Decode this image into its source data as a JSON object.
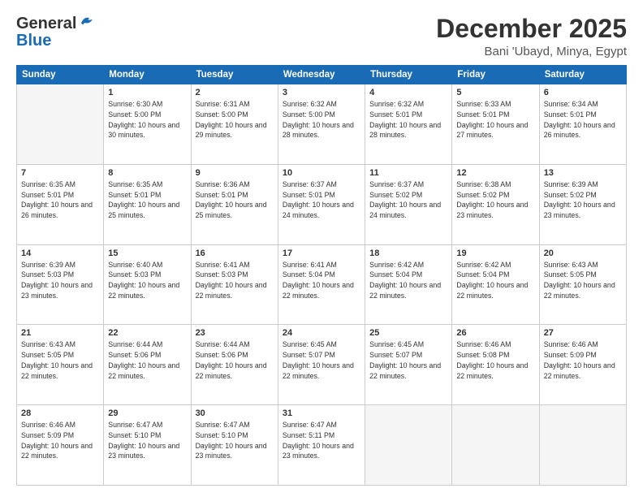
{
  "header": {
    "logo_general": "General",
    "logo_blue": "Blue",
    "month": "December 2025",
    "location": "Bani 'Ubayd, Minya, Egypt"
  },
  "weekdays": [
    "Sunday",
    "Monday",
    "Tuesday",
    "Wednesday",
    "Thursday",
    "Friday",
    "Saturday"
  ],
  "weeks": [
    [
      {
        "day": "",
        "sunrise": "",
        "sunset": "",
        "daylight": ""
      },
      {
        "day": "1",
        "sunrise": "Sunrise: 6:30 AM",
        "sunset": "Sunset: 5:00 PM",
        "daylight": "Daylight: 10 hours and 30 minutes."
      },
      {
        "day": "2",
        "sunrise": "Sunrise: 6:31 AM",
        "sunset": "Sunset: 5:00 PM",
        "daylight": "Daylight: 10 hours and 29 minutes."
      },
      {
        "day": "3",
        "sunrise": "Sunrise: 6:32 AM",
        "sunset": "Sunset: 5:00 PM",
        "daylight": "Daylight: 10 hours and 28 minutes."
      },
      {
        "day": "4",
        "sunrise": "Sunrise: 6:32 AM",
        "sunset": "Sunset: 5:01 PM",
        "daylight": "Daylight: 10 hours and 28 minutes."
      },
      {
        "day": "5",
        "sunrise": "Sunrise: 6:33 AM",
        "sunset": "Sunset: 5:01 PM",
        "daylight": "Daylight: 10 hours and 27 minutes."
      },
      {
        "day": "6",
        "sunrise": "Sunrise: 6:34 AM",
        "sunset": "Sunset: 5:01 PM",
        "daylight": "Daylight: 10 hours and 26 minutes."
      }
    ],
    [
      {
        "day": "7",
        "sunrise": "Sunrise: 6:35 AM",
        "sunset": "Sunset: 5:01 PM",
        "daylight": "Daylight: 10 hours and 26 minutes."
      },
      {
        "day": "8",
        "sunrise": "Sunrise: 6:35 AM",
        "sunset": "Sunset: 5:01 PM",
        "daylight": "Daylight: 10 hours and 25 minutes."
      },
      {
        "day": "9",
        "sunrise": "Sunrise: 6:36 AM",
        "sunset": "Sunset: 5:01 PM",
        "daylight": "Daylight: 10 hours and 25 minutes."
      },
      {
        "day": "10",
        "sunrise": "Sunrise: 6:37 AM",
        "sunset": "Sunset: 5:01 PM",
        "daylight": "Daylight: 10 hours and 24 minutes."
      },
      {
        "day": "11",
        "sunrise": "Sunrise: 6:37 AM",
        "sunset": "Sunset: 5:02 PM",
        "daylight": "Daylight: 10 hours and 24 minutes."
      },
      {
        "day": "12",
        "sunrise": "Sunrise: 6:38 AM",
        "sunset": "Sunset: 5:02 PM",
        "daylight": "Daylight: 10 hours and 23 minutes."
      },
      {
        "day": "13",
        "sunrise": "Sunrise: 6:39 AM",
        "sunset": "Sunset: 5:02 PM",
        "daylight": "Daylight: 10 hours and 23 minutes."
      }
    ],
    [
      {
        "day": "14",
        "sunrise": "Sunrise: 6:39 AM",
        "sunset": "Sunset: 5:03 PM",
        "daylight": "Daylight: 10 hours and 23 minutes."
      },
      {
        "day": "15",
        "sunrise": "Sunrise: 6:40 AM",
        "sunset": "Sunset: 5:03 PM",
        "daylight": "Daylight: 10 hours and 22 minutes."
      },
      {
        "day": "16",
        "sunrise": "Sunrise: 6:41 AM",
        "sunset": "Sunset: 5:03 PM",
        "daylight": "Daylight: 10 hours and 22 minutes."
      },
      {
        "day": "17",
        "sunrise": "Sunrise: 6:41 AM",
        "sunset": "Sunset: 5:04 PM",
        "daylight": "Daylight: 10 hours and 22 minutes."
      },
      {
        "day": "18",
        "sunrise": "Sunrise: 6:42 AM",
        "sunset": "Sunset: 5:04 PM",
        "daylight": "Daylight: 10 hours and 22 minutes."
      },
      {
        "day": "19",
        "sunrise": "Sunrise: 6:42 AM",
        "sunset": "Sunset: 5:04 PM",
        "daylight": "Daylight: 10 hours and 22 minutes."
      },
      {
        "day": "20",
        "sunrise": "Sunrise: 6:43 AM",
        "sunset": "Sunset: 5:05 PM",
        "daylight": "Daylight: 10 hours and 22 minutes."
      }
    ],
    [
      {
        "day": "21",
        "sunrise": "Sunrise: 6:43 AM",
        "sunset": "Sunset: 5:05 PM",
        "daylight": "Daylight: 10 hours and 22 minutes."
      },
      {
        "day": "22",
        "sunrise": "Sunrise: 6:44 AM",
        "sunset": "Sunset: 5:06 PM",
        "daylight": "Daylight: 10 hours and 22 minutes."
      },
      {
        "day": "23",
        "sunrise": "Sunrise: 6:44 AM",
        "sunset": "Sunset: 5:06 PM",
        "daylight": "Daylight: 10 hours and 22 minutes."
      },
      {
        "day": "24",
        "sunrise": "Sunrise: 6:45 AM",
        "sunset": "Sunset: 5:07 PM",
        "daylight": "Daylight: 10 hours and 22 minutes."
      },
      {
        "day": "25",
        "sunrise": "Sunrise: 6:45 AM",
        "sunset": "Sunset: 5:07 PM",
        "daylight": "Daylight: 10 hours and 22 minutes."
      },
      {
        "day": "26",
        "sunrise": "Sunrise: 6:46 AM",
        "sunset": "Sunset: 5:08 PM",
        "daylight": "Daylight: 10 hours and 22 minutes."
      },
      {
        "day": "27",
        "sunrise": "Sunrise: 6:46 AM",
        "sunset": "Sunset: 5:09 PM",
        "daylight": "Daylight: 10 hours and 22 minutes."
      }
    ],
    [
      {
        "day": "28",
        "sunrise": "Sunrise: 6:46 AM",
        "sunset": "Sunset: 5:09 PM",
        "daylight": "Daylight: 10 hours and 22 minutes."
      },
      {
        "day": "29",
        "sunrise": "Sunrise: 6:47 AM",
        "sunset": "Sunset: 5:10 PM",
        "daylight": "Daylight: 10 hours and 23 minutes."
      },
      {
        "day": "30",
        "sunrise": "Sunrise: 6:47 AM",
        "sunset": "Sunset: 5:10 PM",
        "daylight": "Daylight: 10 hours and 23 minutes."
      },
      {
        "day": "31",
        "sunrise": "Sunrise: 6:47 AM",
        "sunset": "Sunset: 5:11 PM",
        "daylight": "Daylight: 10 hours and 23 minutes."
      },
      {
        "day": "",
        "sunrise": "",
        "sunset": "",
        "daylight": ""
      },
      {
        "day": "",
        "sunrise": "",
        "sunset": "",
        "daylight": ""
      },
      {
        "day": "",
        "sunrise": "",
        "sunset": "",
        "daylight": ""
      }
    ]
  ]
}
